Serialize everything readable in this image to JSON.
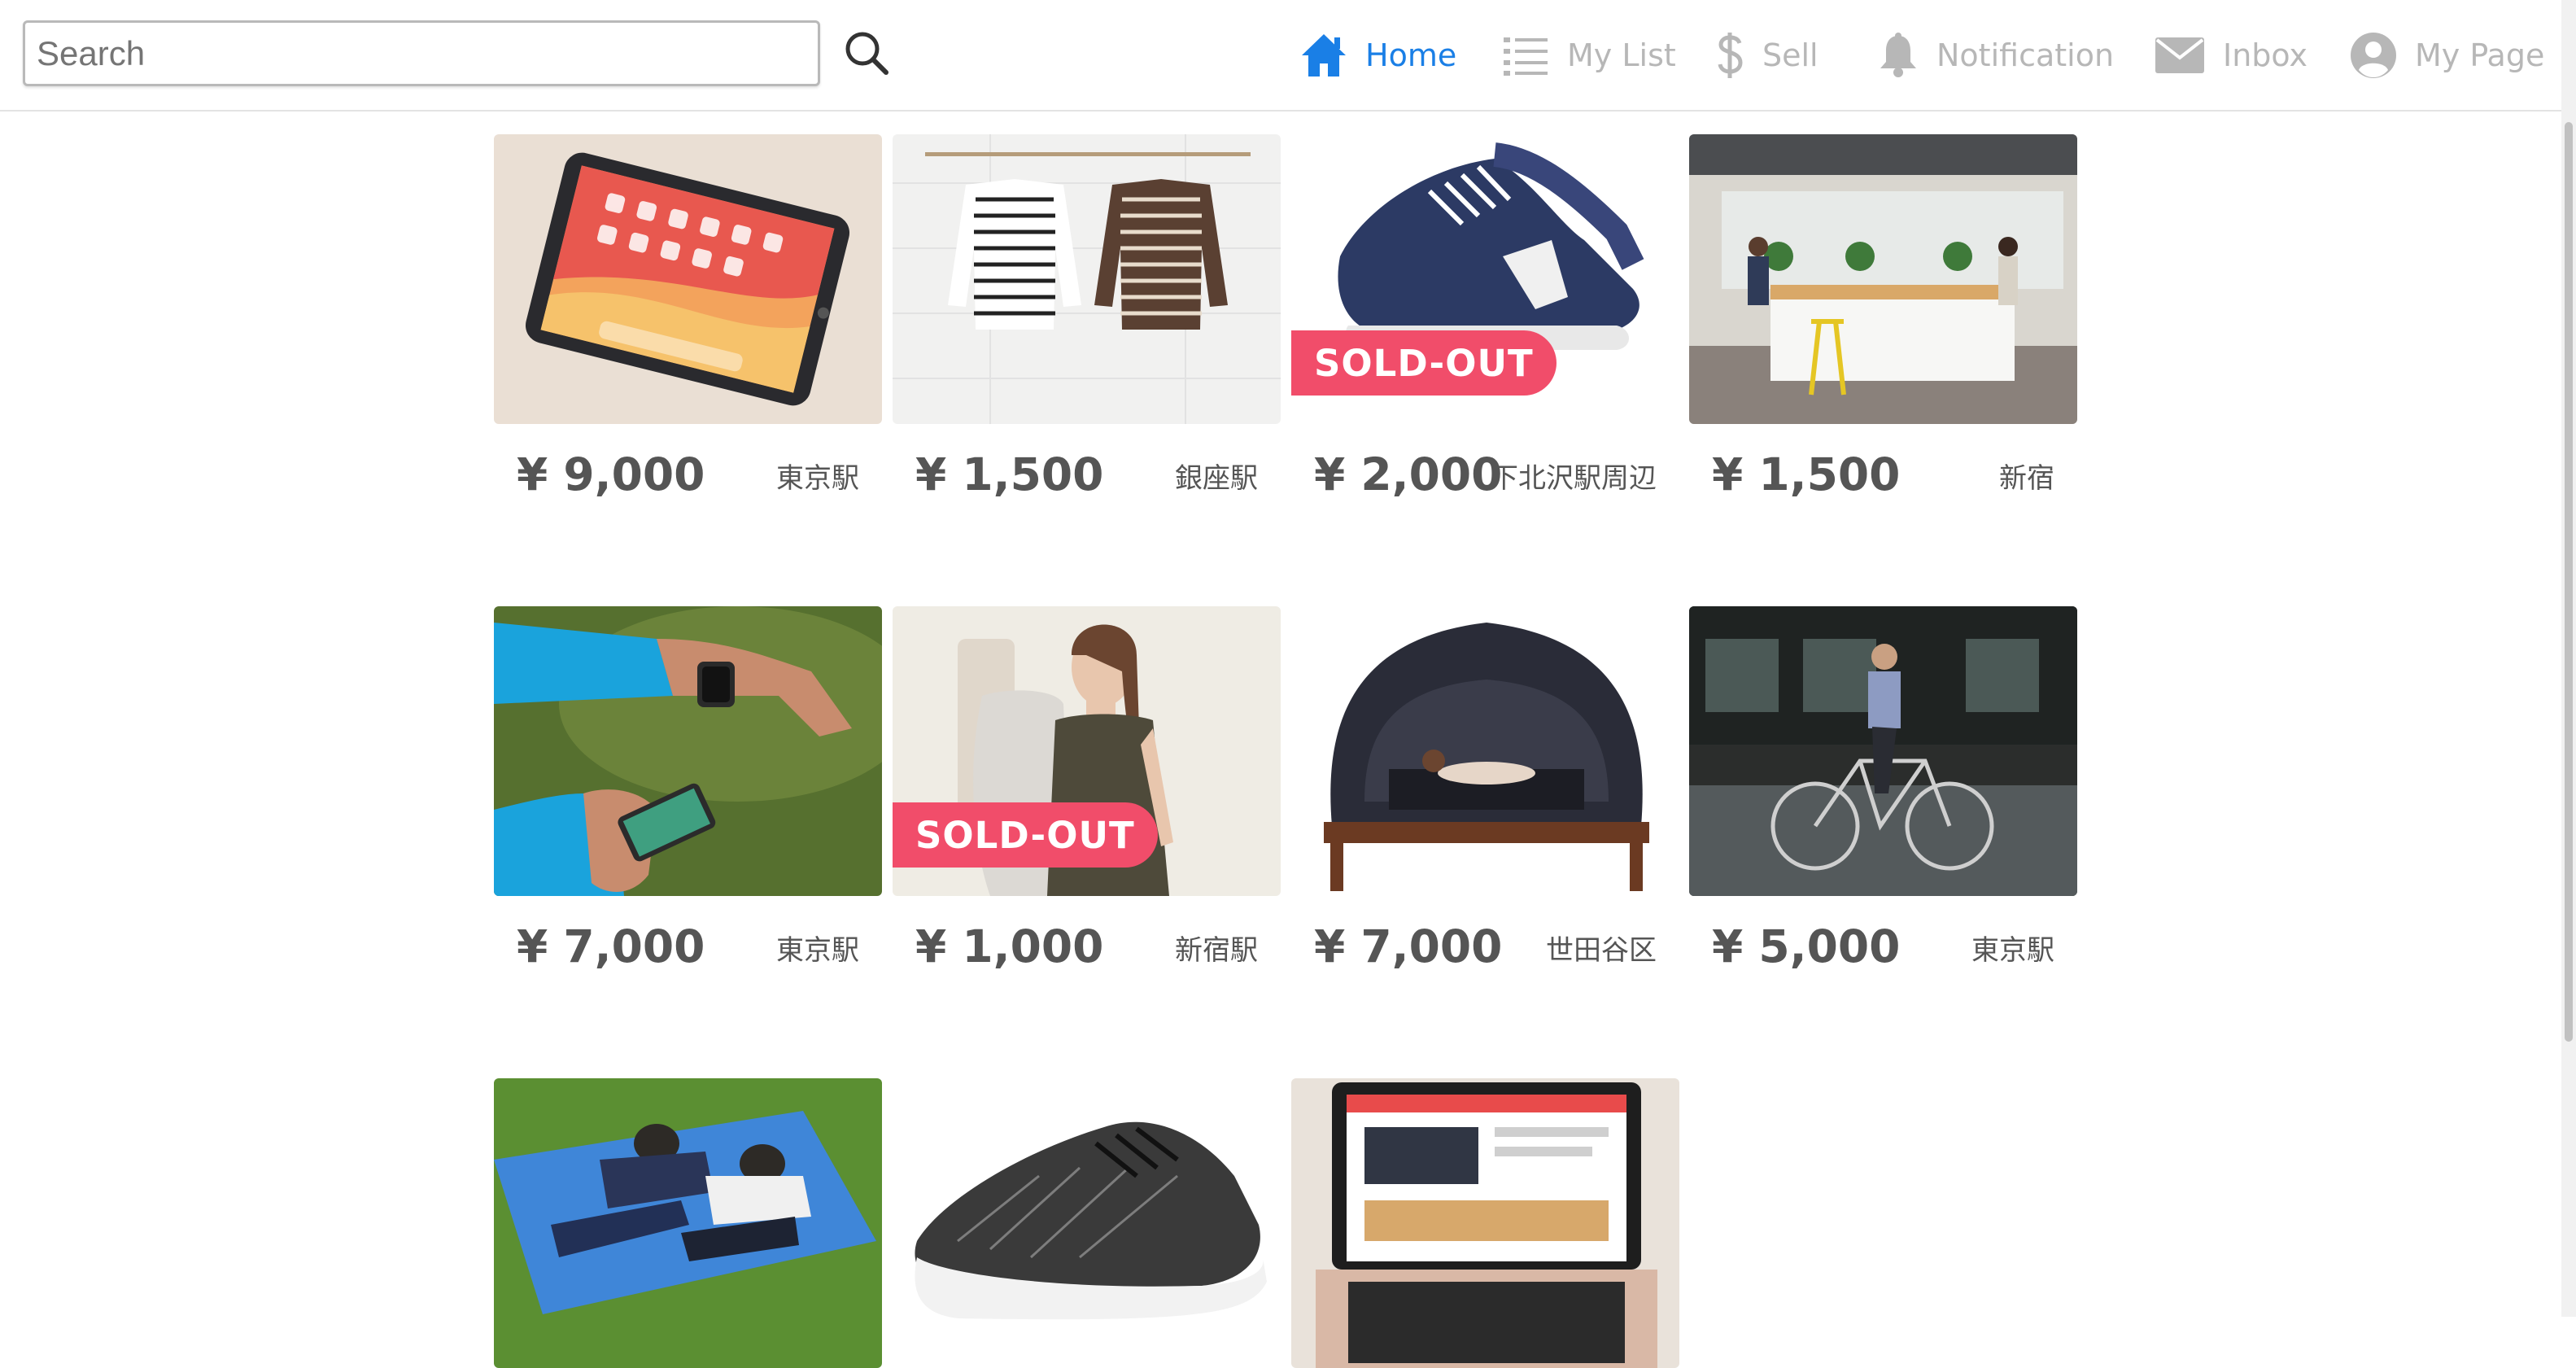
{
  "header": {
    "search": {
      "placeholder": "Search",
      "value": ""
    },
    "nav": [
      {
        "label": "Home",
        "icon": "home-icon",
        "active": true
      },
      {
        "label": "My List",
        "icon": "list-icon",
        "active": false
      },
      {
        "label": "Sell",
        "icon": "dollar-icon",
        "active": false
      },
      {
        "label": "Notification",
        "icon": "bell-icon",
        "active": false
      },
      {
        "label": "Inbox",
        "icon": "mail-icon",
        "active": false
      },
      {
        "label": "My Page",
        "icon": "user-circle-icon",
        "active": false
      }
    ]
  },
  "colors": {
    "accent": "#1a7fe6",
    "nav_inactive": "#b7b7b7",
    "sold_badge": "#f14d6a",
    "price_text": "#555555"
  },
  "items": [
    {
      "price": "¥ 9,000",
      "location": "東京駅",
      "sold_out": false,
      "image": "ipad-tablet"
    },
    {
      "price": "¥ 1,500",
      "location": "銀座駅",
      "sold_out": false,
      "image": "striped-shirts"
    },
    {
      "price": "¥ 2,000",
      "location": "下北沢駅周辺",
      "sold_out": true,
      "image": "navy-sneakers"
    },
    {
      "price": "¥ 1,500",
      "location": "新宿",
      "sold_out": false,
      "image": "office-space"
    },
    {
      "price": "¥ 7,000",
      "location": "東京駅",
      "sold_out": false,
      "image": "smartwatch"
    },
    {
      "price": "¥ 1,000",
      "location": "新宿駅",
      "sold_out": true,
      "image": "woman-backpack"
    },
    {
      "price": "¥ 7,000",
      "location": "世田谷区",
      "sold_out": false,
      "image": "bed-tent"
    },
    {
      "price": "¥ 5,000",
      "location": "東京駅",
      "sold_out": false,
      "image": "bicycle"
    },
    {
      "image": "sleeping-pads"
    },
    {
      "image": "black-sneaker"
    },
    {
      "image": "laptop"
    }
  ],
  "badge_label": "SOLD-OUT"
}
